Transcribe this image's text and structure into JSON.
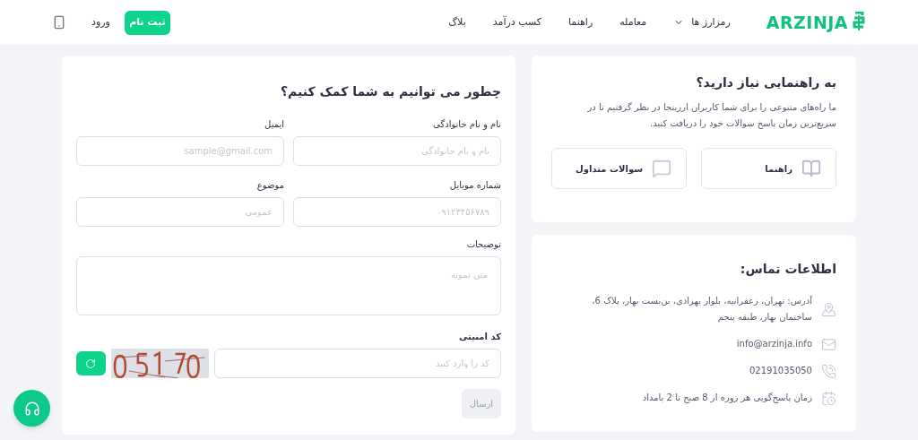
{
  "header": {
    "logo": "ARZINJA",
    "nav": [
      {
        "label": "رمزارز ها",
        "kind": "dropdown"
      },
      {
        "label": "معامله",
        "kind": "link"
      },
      {
        "label": "راهنما",
        "kind": "link"
      },
      {
        "label": "کسب درآمد",
        "kind": "link"
      },
      {
        "label": "بلاگ",
        "kind": "link"
      }
    ],
    "register_button": "ثبت نام",
    "login_link": "ورود"
  },
  "help_card": {
    "title": "به راهنمایی نیاز دارید؟",
    "description": "ما راه‌های متنوعی را برای شما کاربران ارزینجا در نظر گرفتیم تا در سریع‌ترین زمان پاسخ سوالات خود را دریافت کنید.",
    "options": [
      {
        "label": "راهنما",
        "kind": "guide"
      },
      {
        "label": "سوالات متداول",
        "kind": "faq"
      }
    ]
  },
  "contact_card": {
    "title": "اطلاعات تماس:",
    "items": [
      {
        "kind": "address",
        "text": "آدرس: تهران، زعفرانیه، بلوار بهزادی، بن‌بست بهار، پلاک 6، ساختمان بهار، طبقه پنجم"
      },
      {
        "kind": "email",
        "text": "info@arzinja.info"
      },
      {
        "kind": "phone",
        "text": "02191035050"
      },
      {
        "kind": "hours",
        "text": "زمان پاسخ‌گویی هر روزه از 8 صبح تا 2 بامداد"
      }
    ]
  },
  "form": {
    "title": "چطور می توانیم به شما کمک کنیم؟",
    "fields": [
      {
        "label": "نام و نام خانوادگی",
        "placeholder": "نام و نام خانوادگی"
      },
      {
        "label": "ایمیل",
        "placeholder": "sample@gmail.com"
      },
      {
        "label": "شماره موبایل",
        "placeholder": "۰۹۱۲۳۴۵۶۷۸۹"
      },
      {
        "label": "موضوع",
        "placeholder": "عمومی"
      }
    ],
    "description": {
      "label": "توضیحات",
      "placeholder": "متن نمونه"
    },
    "captcha": {
      "label": "کد امنیتی",
      "placeholder": "کد را وارد کنید"
    },
    "submit": {
      "label": "ارسال",
      "disabled": true
    }
  }
}
